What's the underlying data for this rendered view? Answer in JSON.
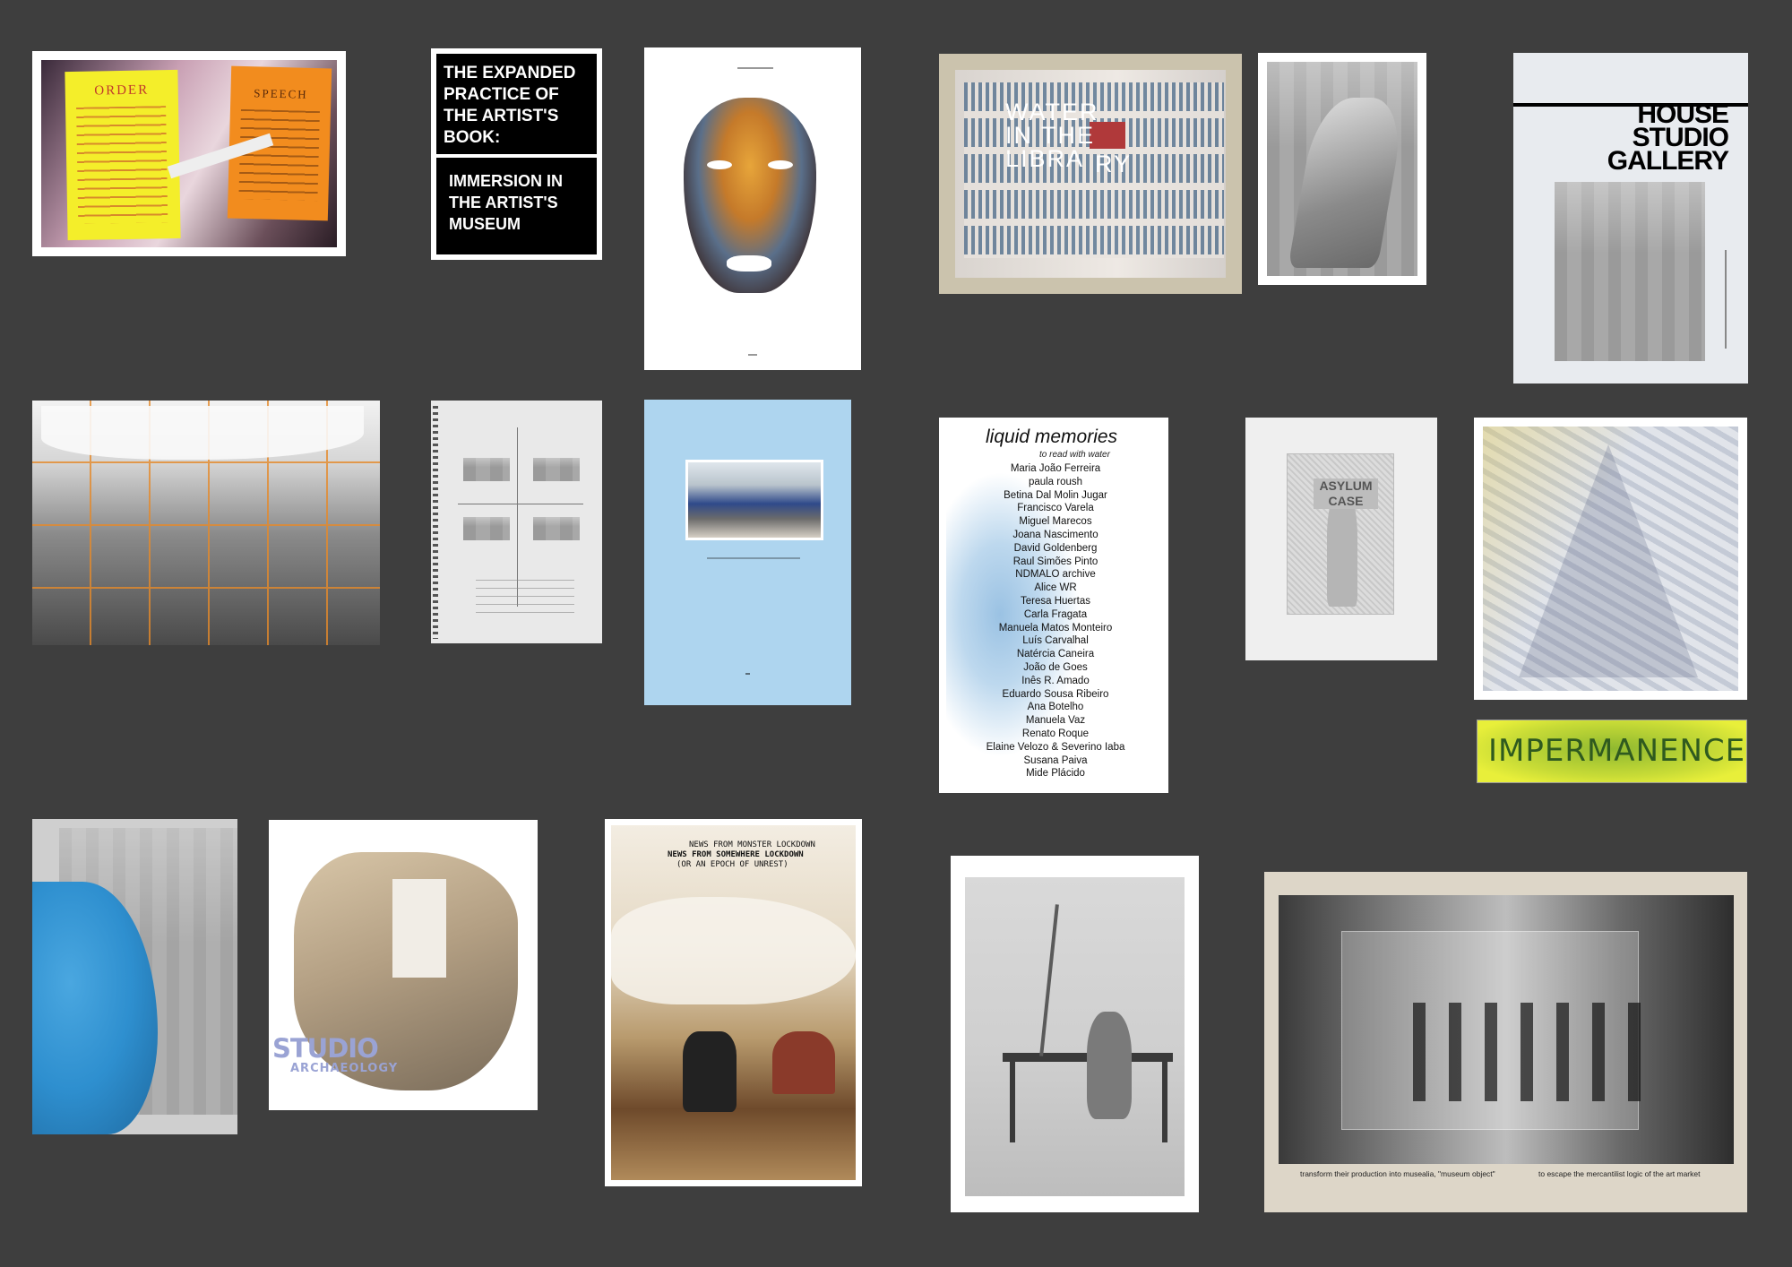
{
  "palette": {
    "background": "#3e3e3e",
    "yellow": "#f4ee2a",
    "orange": "#f28c1e",
    "light_blue": "#aed5ef",
    "lime": "#e8ef3a",
    "lavender": "#9aa3d4",
    "sand": "#cbc3ad",
    "beige": "#ddd6c8"
  },
  "cards": {
    "order_poster": {
      "yellow_title": "ORDER",
      "orange_title": "SPEECH"
    },
    "expanded_practice": {
      "title": "THE EXPANDED PRACTICE OF THE ARTIST'S BOOK:",
      "subtitle": "IMMERSION IN THE ARTIST'S MUSEUM"
    },
    "water_library": {
      "line1": "WATER",
      "line2": "IN THE",
      "line3": "LIBRA",
      "line4": "RY"
    },
    "house_studio_gallery": {
      "line1": "HOUSE",
      "line2": "STUDIO",
      "line3": "GALLERY"
    },
    "liquid_memories": {
      "title": "liquid memories",
      "subtitle": "to read with water",
      "names": [
        "Maria João Ferreira",
        "paula roush",
        "Betina Dal Molin Jugar",
        "Francisco Varela",
        "Miguel Marecos",
        "Joana Nascimento",
        "David Goldenberg",
        "Raul Simões Pinto",
        "NDMALO archive",
        "Alice WR",
        "Teresa Huertas",
        "Carla Fragata",
        "Manuela Matos Monteiro",
        "Luís Carvalhal",
        "Natércia Caneira",
        "João de Goes",
        "Inês R. Amado",
        "Eduardo Sousa Ribeiro",
        "Ana Botelho",
        "Manuela Vaz",
        "Renato Roque",
        "Elaine Velozo & Severino Iaba",
        "Susana Paiva",
        "Mide Plácido"
      ]
    },
    "asylum_case": {
      "title": "ASYLUM CASE"
    },
    "impermanence": {
      "title": "IMPERMANENCE"
    },
    "studio_archaeology": {
      "line1": "STUDIO",
      "line2": "ARCHAEOLOGY"
    },
    "news_from_lockdown": {
      "line1": "NEWS FROM MONSTER LOCKDOWN",
      "line2": "NEWS FROM SOMEWHERE LOCKDOWN",
      "line3": "(OR AN EPOCH OF UNREST)"
    },
    "museum_object": {
      "caption_left": "transform their production into musealia, \"museum object\"",
      "caption_right": "to escape the mercantilist logic of the art market"
    }
  }
}
